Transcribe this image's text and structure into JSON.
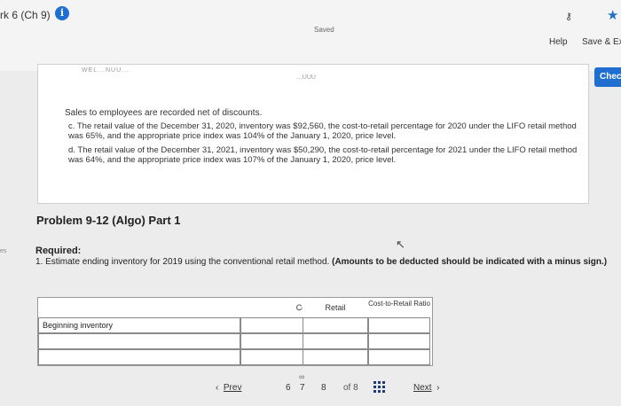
{
  "header": {
    "title": "rk 6 (Ch 9)",
    "saved_label": "Saved",
    "help_label": "Help",
    "save_exit_label": "Save & Ex",
    "check_label": "Check"
  },
  "icons": {
    "info": "info-icon",
    "key": "key-icon",
    "star": "star-icon",
    "cursor": "cursor-icon",
    "link": "link-icon",
    "grid": "grid-icon"
  },
  "colors": {
    "accent": "#1f6fd1"
  },
  "card": {
    "faded_row_label": "WEL...NUU...",
    "faded_row_value": "...,UUU",
    "note": "Sales to employees are recorded net of discounts.",
    "item_c": "c. The retail value of the December 31, 2020, inventory was $92,560, the cost-to-retail percentage for 2020 under the LIFO retail method was 65%, and the appropriate price index was 104% of the January 1, 2020, price level.",
    "item_d": "d. The retail value of the December 31, 2021, inventory was $50,290, the cost-to-retail percentage for 2021 under the LIFO retail method was 64%, and the appropriate price index was 107% of the January 1, 2020, price level."
  },
  "problem": {
    "title": "Problem 9-12 (Algo) Part 1",
    "required_head": "Required:",
    "required_text": "1. Estimate ending inventory for 2019 using the conventional retail method.",
    "required_bold": "(Amounts to be deducted should be indicated with a minus sign.)",
    "left_edge_label": "es"
  },
  "table": {
    "headers": [
      "",
      "Cost",
      "Retail",
      "Cost-to-Retail Ratio"
    ],
    "rows": [
      [
        "Beginning inventory",
        "",
        "",
        ""
      ],
      [
        "",
        "",
        "",
        ""
      ],
      [
        "",
        "",
        "",
        ""
      ]
    ]
  },
  "pagination": {
    "prev_label": "Prev",
    "pages": [
      "6",
      "7",
      "8"
    ],
    "of_label": "of 8",
    "next_label": "Next"
  }
}
